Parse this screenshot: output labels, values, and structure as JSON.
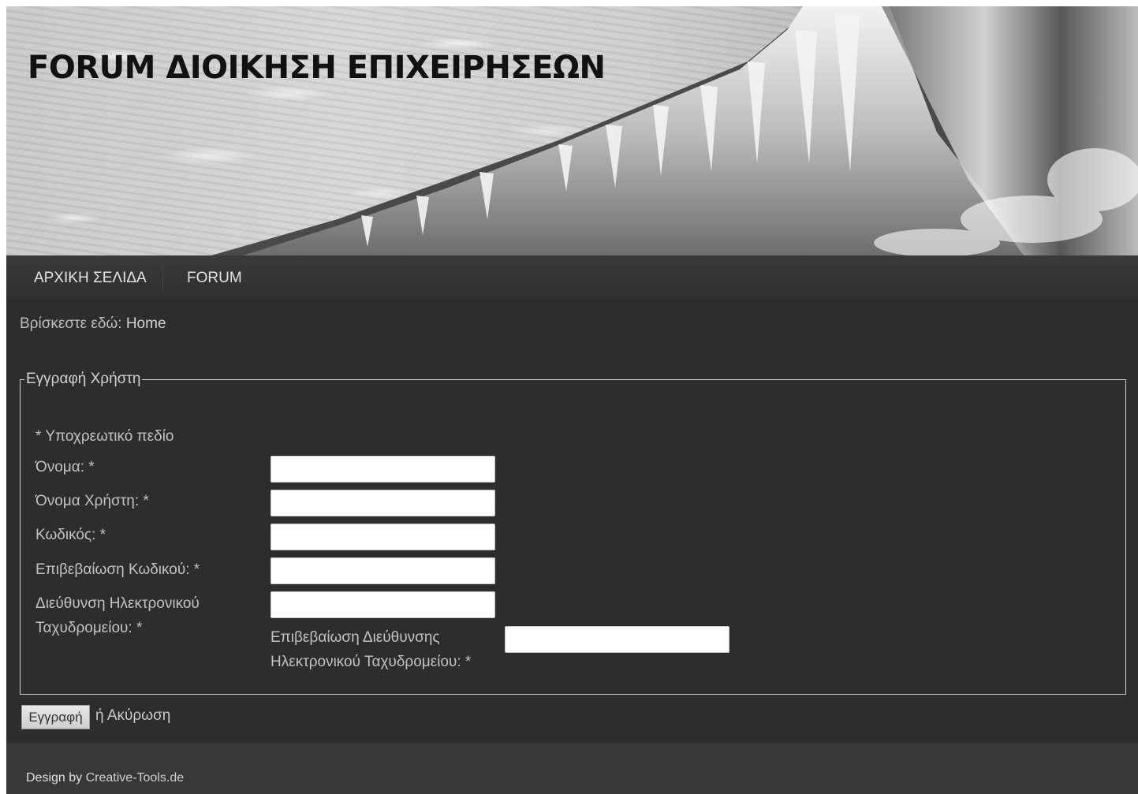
{
  "header": {
    "site_title": "FORUM ΔΙΟΙΚΗΣΗ ΕΠΙΧΕΙΡΗΣΕΩΝ"
  },
  "nav": {
    "items": [
      {
        "label": "ΑΡΧΙΚΗ ΣΕΛΙΔΑ"
      },
      {
        "label": "FORUM"
      }
    ]
  },
  "breadcrumb": {
    "prefix": "Βρίσκεστε εδώ:",
    "current": "Home"
  },
  "registration": {
    "legend": "Εγγραφή Χρήστη",
    "required_note": "* Υποχρεωτικό πεδίο",
    "name_label": "Όνομα: *",
    "name_value": "",
    "username_label": "Όνομα Χρήστη: *",
    "username_value": "",
    "password_label": "Κωδικός: *",
    "password_value": "",
    "confirm_password_label": "Επιβεβαίωση Κωδικού: *",
    "confirm_password_value": "",
    "email_label_line1": "Διεύθυνση Ηλεκτρονικού",
    "email_label_line2": "Ταχυδρομείου: *",
    "email_value": "",
    "confirm_email_label_line1": "Επιβεβαίωση Διεύθυνσης",
    "confirm_email_label_line2": "Ηλεκτρονικού Ταχυδρομείου: *",
    "confirm_email_value": ""
  },
  "actions": {
    "submit_label": "Εγγραφή",
    "or_text": "ή",
    "cancel_label": "Ακύρωση"
  },
  "footer": {
    "design_by": "Design by",
    "credit_link": "Creative-Tools.de"
  }
}
